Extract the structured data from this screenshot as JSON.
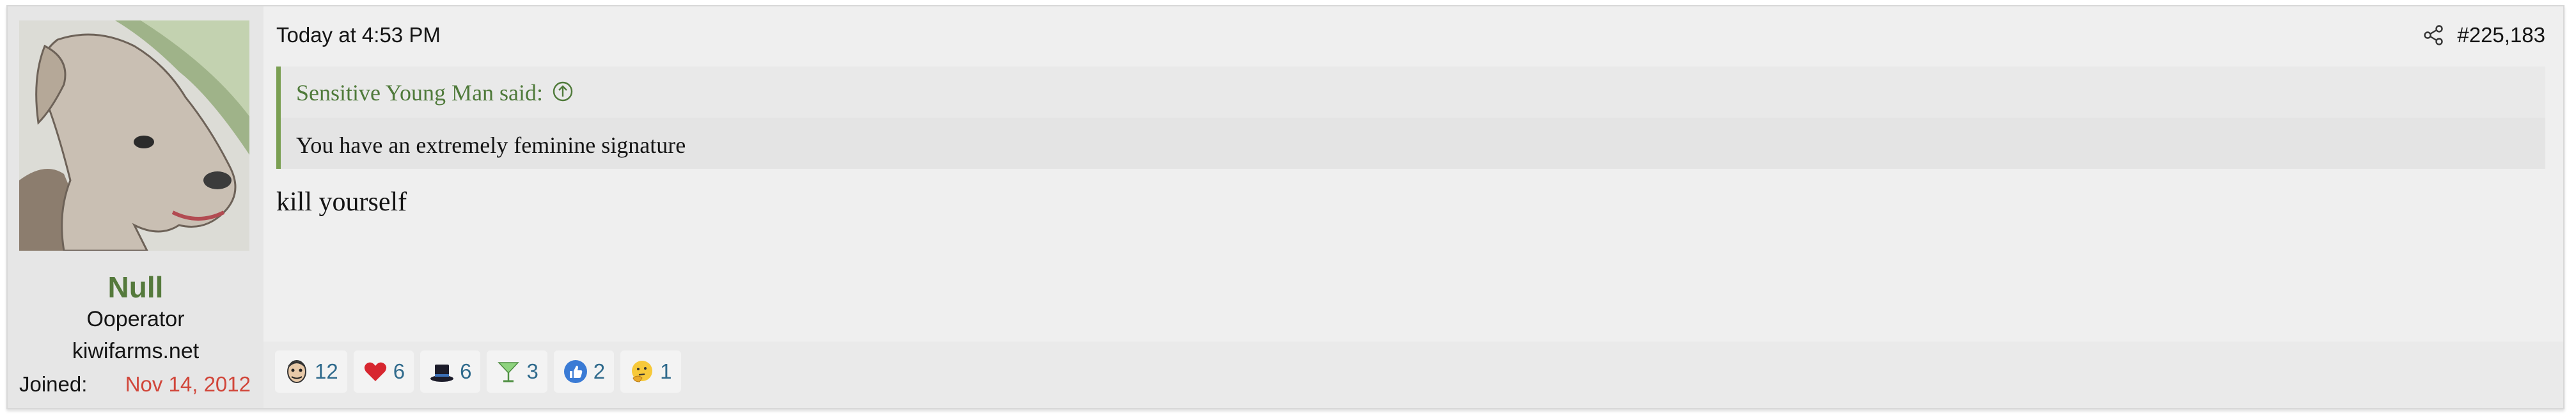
{
  "user": {
    "name": "Null",
    "title": "Ooperator",
    "banner": "kiwifarms.net",
    "joined_label": "Joined:",
    "joined_date": "Nov 14, 2012",
    "avatar_icon": "dog-avatar-icon"
  },
  "post": {
    "timestamp": "Today at 4:53 PM",
    "number": "#225,183",
    "share_icon": "share-icon",
    "quote": {
      "author": "Sensitive Young Man said:",
      "jump_icon": "arrow-up-circle-icon",
      "text": "You have an extremely feminine signature"
    },
    "message": "kill yourself"
  },
  "reactions": [
    {
      "icon": "face-reaction-icon",
      "count": "12"
    },
    {
      "icon": "heart-icon",
      "count": "6"
    },
    {
      "icon": "top-hat-icon",
      "count": "6"
    },
    {
      "icon": "cocktail-icon",
      "count": "3"
    },
    {
      "icon": "thumbs-up-icon",
      "count": "2"
    },
    {
      "icon": "thinking-face-icon",
      "count": "1"
    }
  ],
  "colors": {
    "username": "#557a3c",
    "quote_author": "#4f7a3a",
    "quote_border": "#7a9f52",
    "joined_date": "#d1463a",
    "reaction_count": "#2f6a8c"
  }
}
